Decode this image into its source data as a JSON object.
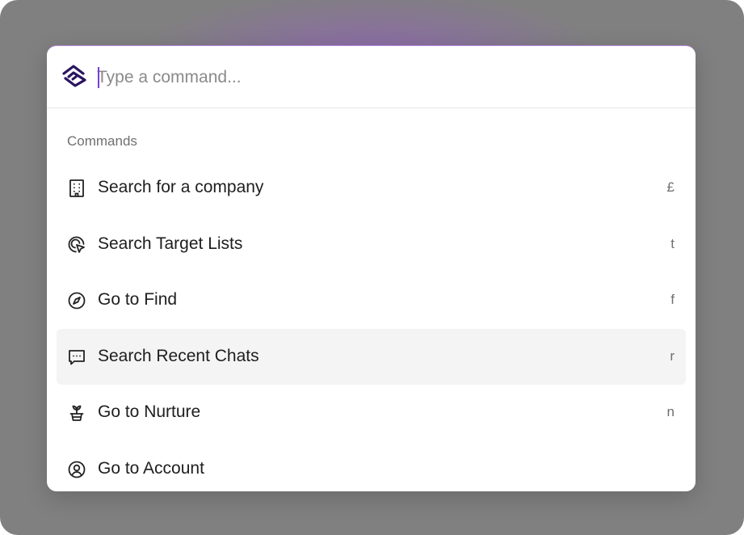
{
  "search": {
    "placeholder": "Type a command...",
    "value": ""
  },
  "section": {
    "title": "Commands"
  },
  "commands": [
    {
      "label": "Search for a company",
      "shortcut": "£",
      "icon": "building-icon"
    },
    {
      "label": "Search Target Lists",
      "shortcut": "t",
      "icon": "target-cursor-icon"
    },
    {
      "label": "Go to Find",
      "shortcut": "f",
      "icon": "compass-icon"
    },
    {
      "label": "Search Recent Chats",
      "shortcut": "r",
      "icon": "chat-icon",
      "selected": true
    },
    {
      "label": "Go to Nurture",
      "shortcut": "n",
      "icon": "sprout-pot-icon"
    },
    {
      "label": "Go to Account",
      "shortcut": "",
      "icon": "user-circle-icon"
    }
  ],
  "colors": {
    "backdrop": "#808080",
    "accent": "#7b3fd6",
    "logo": "#2a1460",
    "selected_row": "#f4f4f4"
  }
}
